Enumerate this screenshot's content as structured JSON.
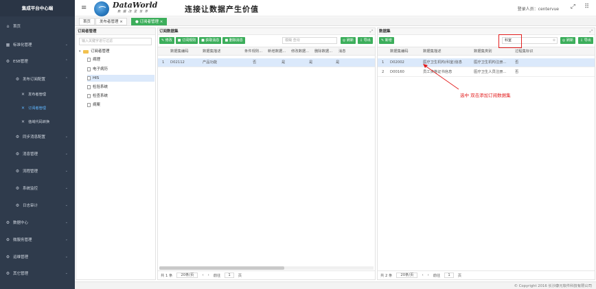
{
  "sidebar": {
    "title": "集成平台中心端",
    "items": [
      {
        "label": "首页",
        "icon": "home-icon",
        "level": 0
      },
      {
        "label": "标准化管理",
        "icon": "grid-icon",
        "level": 0
      },
      {
        "label": "ESB管理",
        "icon": "gear-icon",
        "level": 0
      },
      {
        "label": "发布订阅配置",
        "icon": "gear-icon",
        "level": 1
      },
      {
        "label": "发布者管理",
        "icon": "wrench-icon",
        "level": 2
      },
      {
        "label": "订阅者管理",
        "icon": "wrench-icon",
        "level": 2,
        "active": true
      },
      {
        "label": "值域代码转换",
        "icon": "wrench-icon",
        "level": 2
      },
      {
        "label": "同步消息配置",
        "icon": "gear-icon",
        "level": 1
      },
      {
        "label": "消息管理",
        "icon": "gear-icon",
        "level": 1
      },
      {
        "label": "流程管理",
        "icon": "gear-icon",
        "level": 1
      },
      {
        "label": "系统监控",
        "icon": "gear-icon",
        "level": 1
      },
      {
        "label": "日志审计",
        "icon": "gear-icon",
        "level": 1
      },
      {
        "label": "数据中心",
        "icon": "gear-icon",
        "level": 0
      },
      {
        "label": "微服务管理",
        "icon": "gear-icon",
        "level": 0
      },
      {
        "label": "运维管理",
        "icon": "gear-icon",
        "level": 0
      },
      {
        "label": "其它管理",
        "icon": "gear-icon",
        "level": 0
      }
    ]
  },
  "header": {
    "brand": "DataWorld",
    "brand_sub": "数 据 改 变 世 界",
    "slogan": "连接让数据产生价值",
    "login_user": "登录人员：centervue"
  },
  "tabs": [
    {
      "label": "首页"
    },
    {
      "label": "发布者管理 ×"
    },
    {
      "label": "● 订阅者管理 ×",
      "active": true
    }
  ],
  "subscriber_panel": {
    "title": "订阅者管理",
    "filter_placeholder": "输入关键字进行过滤",
    "tree": [
      {
        "label": "订阅者管理",
        "type": "root"
      },
      {
        "label": "病理",
        "type": "doc"
      },
      {
        "label": "电子病历",
        "type": "doc"
      },
      {
        "label": "HIS",
        "type": "doc",
        "selected": true
      },
      {
        "label": "检验系统",
        "type": "doc"
      },
      {
        "label": "检查系统",
        "type": "doc"
      },
      {
        "label": "病案",
        "type": "doc"
      }
    ]
  },
  "subscription_panel": {
    "title": "订阅数据集",
    "buttons": [
      "✎ 修改",
      "■ 订阅规则",
      "■ 获取消息",
      "■ 删除消息"
    ],
    "search_placeholder": "模糊 查询",
    "refresh_label": "◎ 刷新",
    "export_label": "⇩ 导出",
    "columns": [
      "数据集编码",
      "数据集描述",
      "条件规则...",
      "新增数据...",
      "修改数据...",
      "删除数据...",
      "消息"
    ],
    "rows": [
      {
        "no": "1",
        "code": "D02112",
        "desc": "产品功能",
        "cond": "否",
        "add": "是",
        "mod": "是",
        "del": "是"
      }
    ],
    "pager": {
      "total": "共 1 条",
      "size": "20条/页",
      "goto": "前往",
      "page": "1",
      "unit": "页"
    }
  },
  "dataset_panel": {
    "title": "数据集",
    "button": "✎ 新增",
    "search_value": "科室",
    "refresh_label": "◎ 刷新",
    "export_label": "⇩ 导出",
    "columns": [
      "数据集编码",
      "数据集描述",
      "数据集类别",
      "过程集标识"
    ],
    "rows": [
      {
        "no": "1",
        "code": "D02002",
        "desc": "医疗卫生机构(科室)信息",
        "cat": "医疗卫生机构注册...",
        "flag": "否"
      },
      {
        "no": "2",
        "code": "D00160",
        "desc": "员工资格证书信息",
        "cat": "医疗卫生人员注册...",
        "flag": "否"
      }
    ],
    "pager": {
      "total": "共 2 条",
      "size": "20条/页",
      "goto": "前往",
      "page": "1",
      "unit": "页"
    }
  },
  "annotation": {
    "text": "选中 双击添加订阅数据集",
    "color": "#e21b1b"
  },
  "footer": {
    "copyright": "© Copyright 2016 长沙康元软件科技有限公司"
  },
  "colors": {
    "sidebar_bg": "#2f3b4c",
    "accent_green": "#3cae5b",
    "active_blue": "#5fb6ff",
    "highlight_row": "#dbe9fb"
  }
}
